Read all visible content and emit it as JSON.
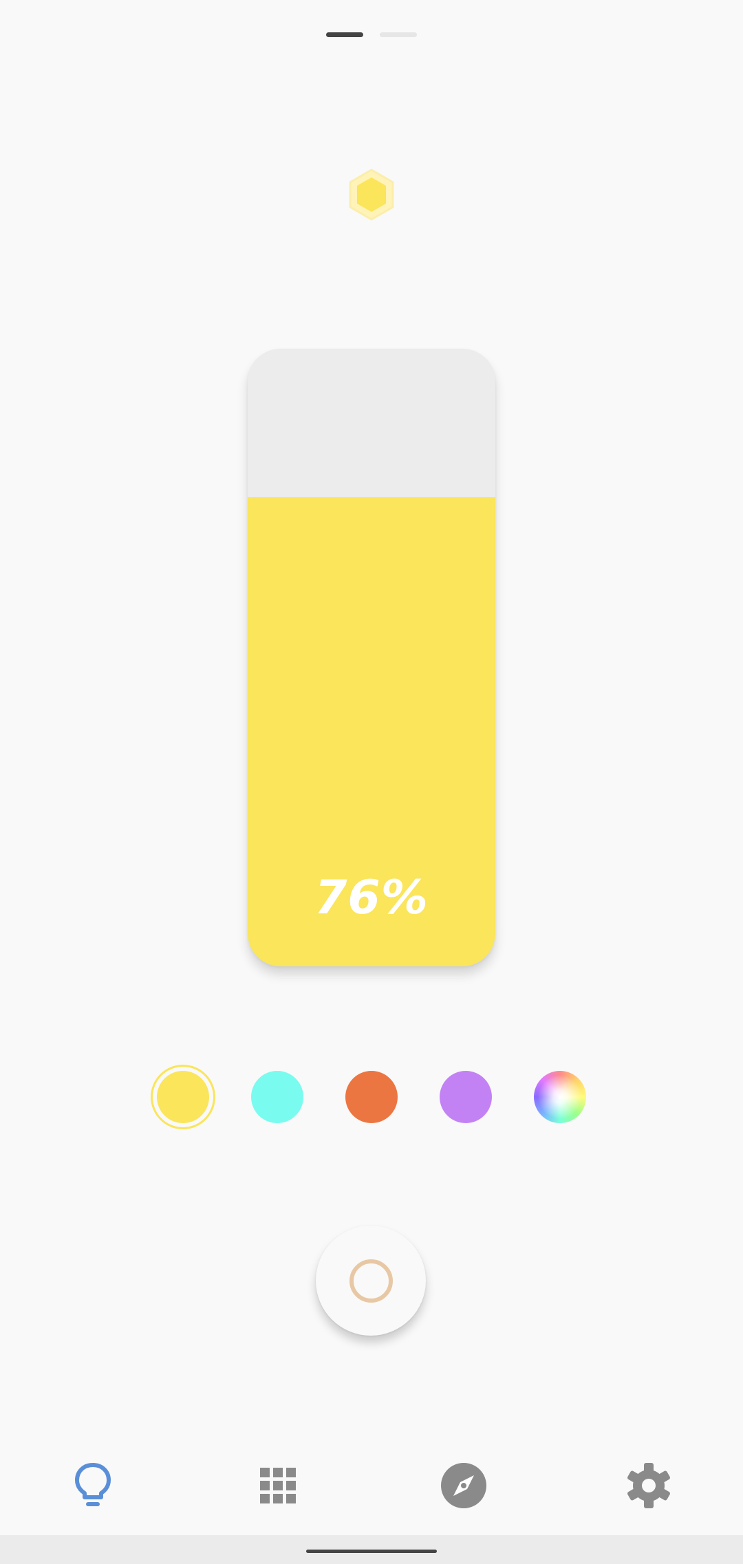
{
  "pager": {
    "pages": [
      "light",
      "other"
    ],
    "active_index": 0
  },
  "status_icon": {
    "name": "hexagon-icon",
    "color": "#fae55b"
  },
  "brightness": {
    "label": "76%",
    "fraction": 0.76,
    "fill_color": "#fae55b",
    "track_color": "#ececec"
  },
  "color_swatches": [
    {
      "name": "yellow",
      "color": "#fae55b",
      "selected": true
    },
    {
      "name": "cyan",
      "color": "#7afbef",
      "selected": false
    },
    {
      "name": "orange",
      "color": "#ec7641",
      "selected": false
    },
    {
      "name": "purple",
      "color": "#c382f4",
      "selected": false
    },
    {
      "name": "custom-color-wheel",
      "color": "rainbow",
      "selected": false
    }
  ],
  "power_button": {
    "ring_color": "#e8c8a4"
  },
  "bottom_nav": [
    {
      "name": "lightbulb-icon",
      "active": true,
      "color": "#5a8fd8"
    },
    {
      "name": "grid-icon",
      "active": false,
      "color": "#8a8a8a"
    },
    {
      "name": "compass-icon",
      "active": false,
      "color": "#8a8a8a"
    },
    {
      "name": "gear-icon",
      "active": false,
      "color": "#8a8a8a"
    }
  ]
}
